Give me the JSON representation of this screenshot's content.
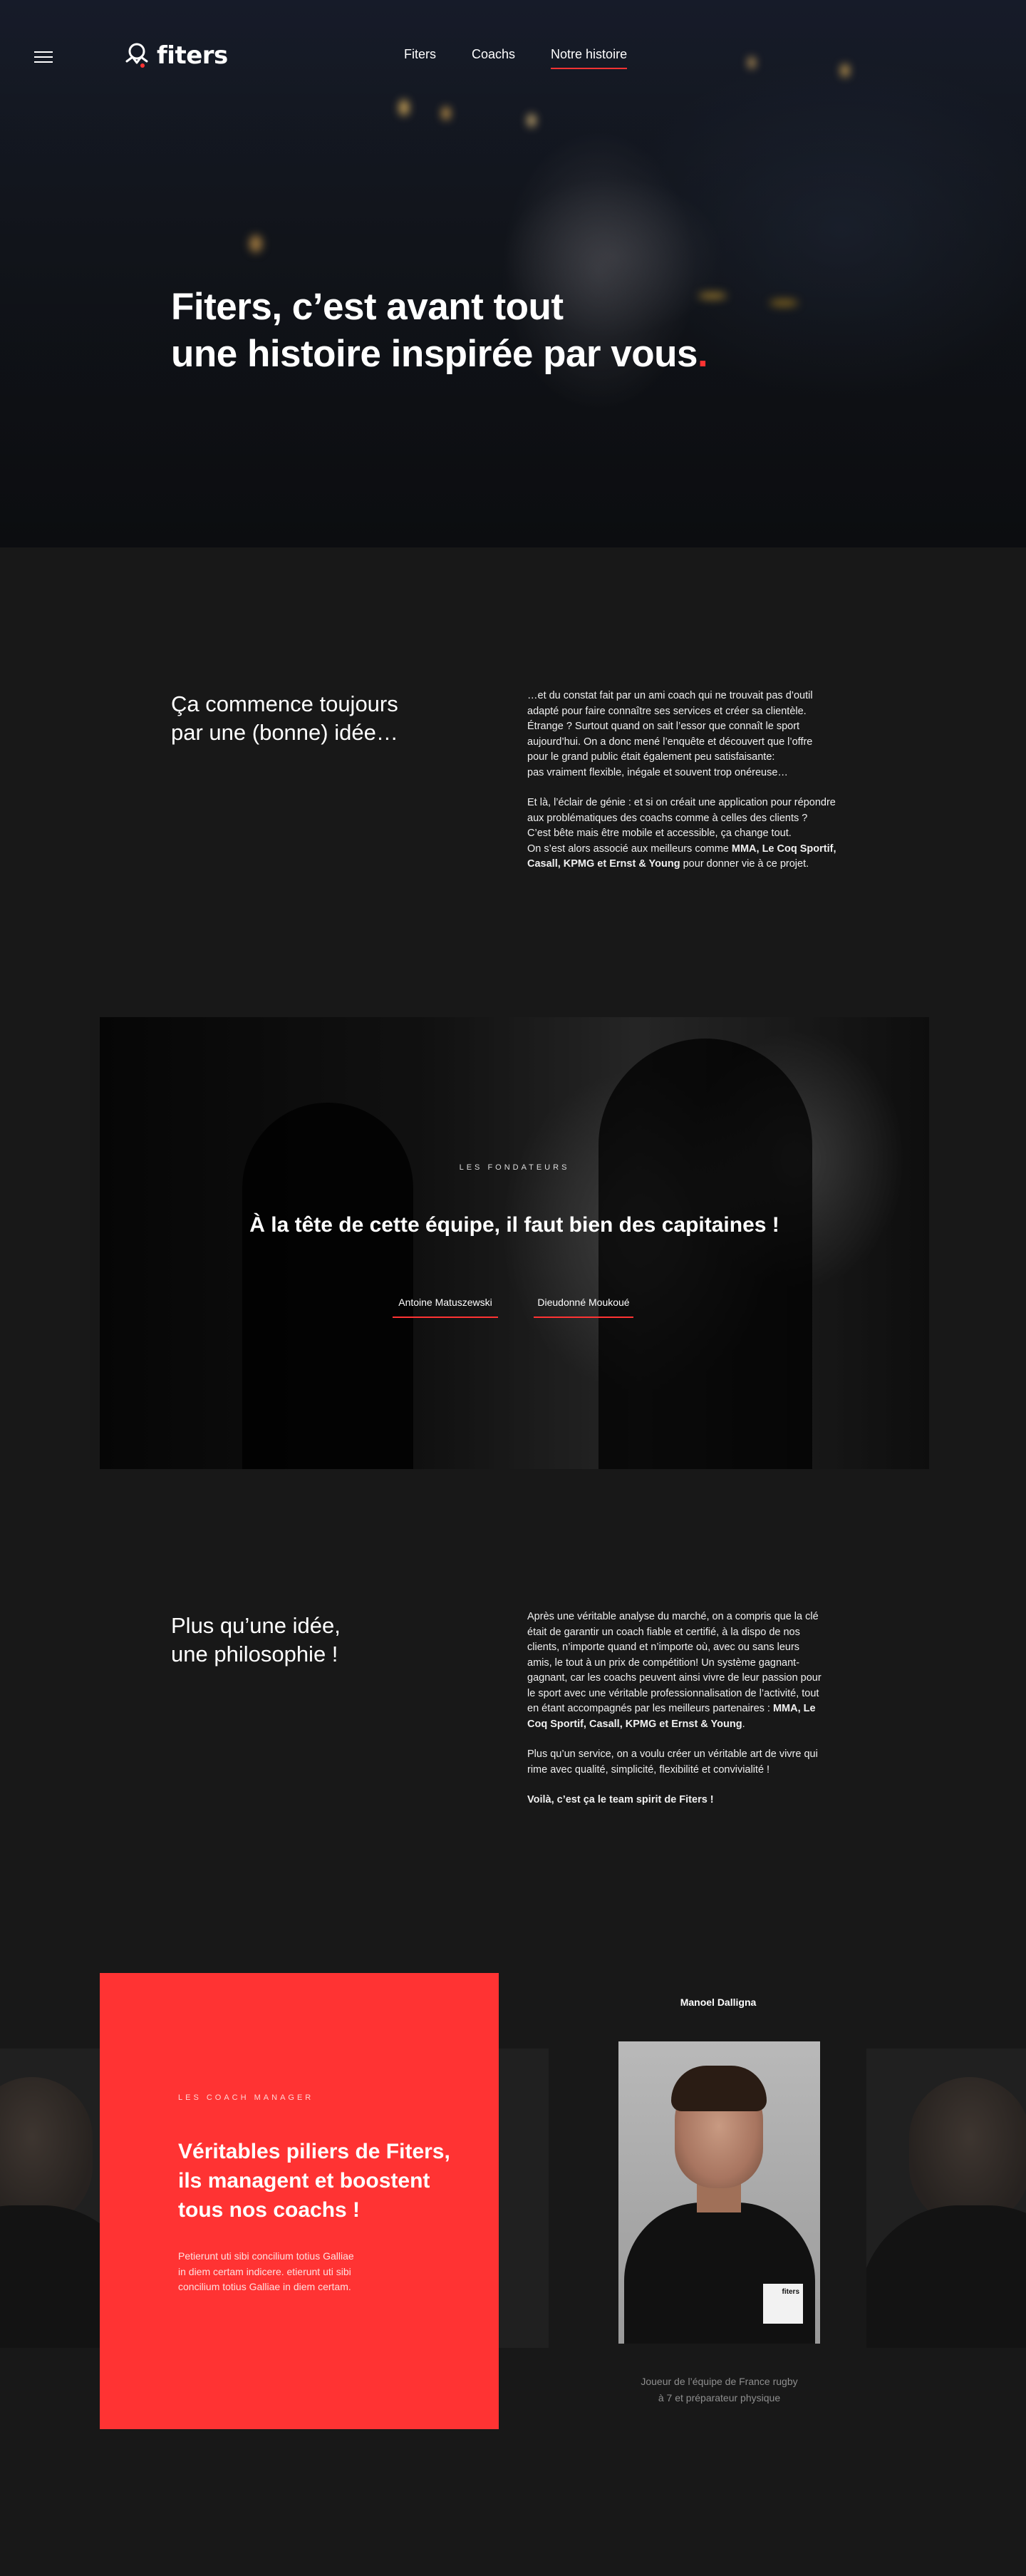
{
  "nav": {
    "logo_text": "fiters",
    "links": [
      {
        "label": "Fiters"
      },
      {
        "label": "Coachs"
      },
      {
        "label": "Notre histoire"
      }
    ]
  },
  "hero": {
    "title_line1": "Fiters, c’est avant tout",
    "title_line2": "une histoire inspirée par vous",
    "title_dot": "."
  },
  "idea": {
    "heading_line1": "Ça commence toujours",
    "heading_line2": "par une (bonne) idée…",
    "p1": [
      "…et du constat fait par un ami coach qui ne trouvait pas d’outil",
      "adapté pour faire connaître ses services et créer sa clientèle.",
      "Étrange ? Surtout quand on sait l’essor que connaît le sport",
      "aujourd’hui. On a donc mené l’enquête et découvert que l’offre",
      "pour le grand public était également peu satisfaisante:",
      "pas vraiment flexible, inégale et souvent trop onéreuse…"
    ],
    "p2": [
      "Et là, l’éclair de génie : et si on créait une application pour répondre",
      "aux problématiques des coachs comme à celles des clients ?",
      "C’est bête mais être mobile et accessible, ça change tout.",
      " On s’est alors associé aux meilleurs comme "
    ],
    "p2_partners_a": "MMA, Le Coq Sportif,",
    "p2_partners_b": "Casall, KPMG et Ernst & Young",
    "p2_end": " pour donner vie à ce projet."
  },
  "founders": {
    "kicker": "LES FONDATEURS",
    "title": "À la tête de cette équipe, il faut bien des capitaines !",
    "names": [
      "Antoine Matuszewski",
      "Dieudonné Moukoué"
    ]
  },
  "philosophy": {
    "heading_line1": "Plus qu’une idée,",
    "heading_line2": "une philosophie !",
    "p1": [
      "Après une véritable analyse du marché, on a compris que la clé",
      "était de garantir un coach fiable et certifié, à la dispo de nos",
      "clients, n’importe quand et n’importe où, avec ou sans leurs",
      "amis, le tout à un prix de compétition! Un système gagnant-",
      "gagnant, car les coachs peuvent ainsi vivre de leur passion pour",
      "le sport avec une véritable professionnalisation de l’activité, tout",
      "en étant accompagnés par les meilleurs partenaires : "
    ],
    "p1_partners_a": "MMA, Le",
    "p1_partners_b": "Coq Sportif, Casall, KPMG et Ernst & Young",
    "p1_end": ".",
    "p2": [
      "Plus qu’un service, on a voulu créer un véritable art de vivre qui",
      "rime avec qualité, simplicité, flexibilité et convivialité !"
    ],
    "p3": "Voilà, c’est ça le team spirit de Fiters !"
  },
  "coach_manager": {
    "kicker": "LES COACH MANAGER",
    "title_lines": [
      "Véritables piliers de Fiters,",
      "ils managent et boostent",
      "tous nos coachs !"
    ],
    "text_lines": [
      "Petierunt uti sibi concilium totius Galliae",
      "in diem certam indicere. etierunt uti sibi",
      "concilium totius Galliae in diem certam."
    ],
    "coach_name": "Manoel Dalligna",
    "coach_badge": "fiters",
    "caption_lines": [
      "Joueur de l’équipe de France rugby",
      "à 7 et préparateur physique"
    ]
  },
  "colors": {
    "accent": "#ff3333",
    "background": "#181818"
  }
}
